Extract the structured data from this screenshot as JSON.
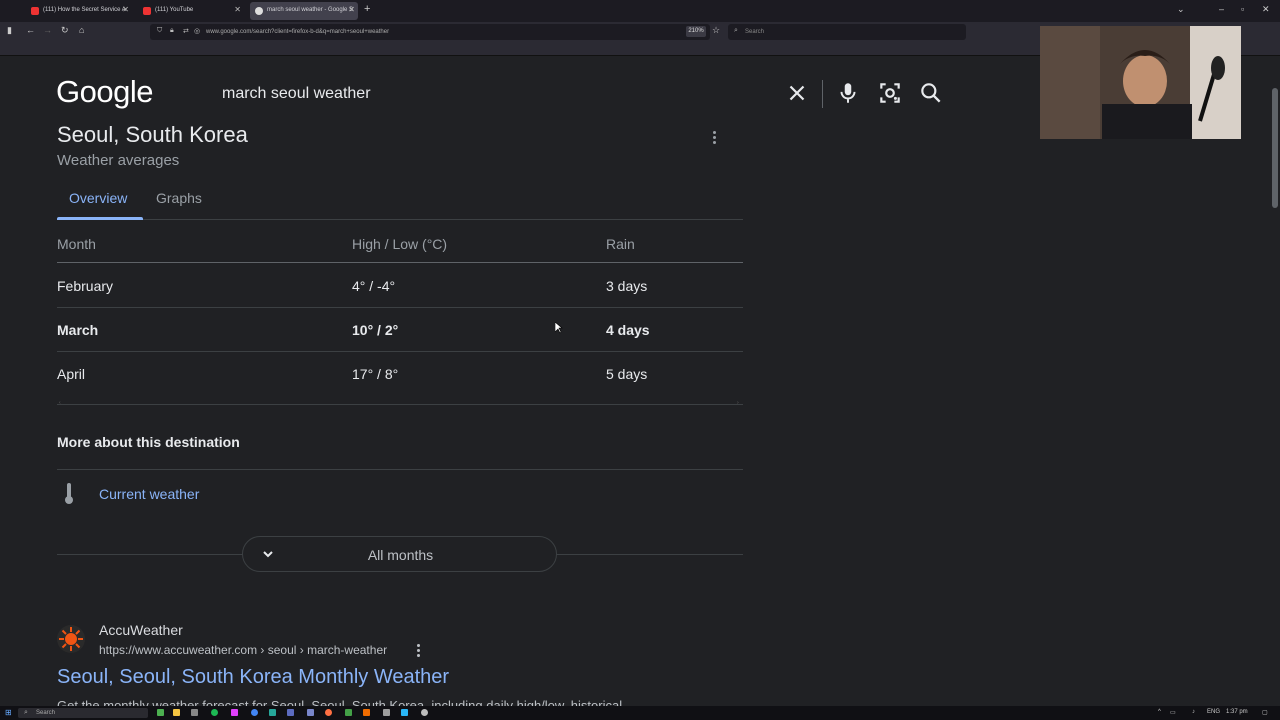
{
  "browser": {
    "tabs": [
      {
        "title": "(111) How the Secret Service A",
        "active": false
      },
      {
        "title": "(111) YouTube",
        "active": false
      },
      {
        "title": "march seoul weather - Google S",
        "active": true
      }
    ],
    "url": "www.google.com/search?client=firefox-b-d&q=march+seoul+weather",
    "zoom": "210%",
    "search_placeholder": "Search"
  },
  "google": {
    "logo": "Google",
    "query": "march seoul weather",
    "icons": [
      "close-icon",
      "microphone-icon",
      "lens-icon",
      "search-icon"
    ]
  },
  "weather_card": {
    "title": "Seoul, South Korea",
    "subtitle": "Weather averages",
    "tabs": [
      "Overview",
      "Graphs"
    ],
    "columns": [
      "Month",
      "High / Low (°C)",
      "Rain"
    ],
    "rows": [
      {
        "month": "February",
        "temp": "4° / -4°",
        "rain": "3 days",
        "highlight": false
      },
      {
        "month": "March",
        "temp": "10° / 2°",
        "rain": "4 days",
        "highlight": true
      },
      {
        "month": "April",
        "temp": "17° / 8°",
        "rain": "5 days",
        "highlight": false
      }
    ],
    "more_title": "More about this destination",
    "current_weather_link": "Current weather",
    "all_months_button": "All months"
  },
  "result": {
    "site_name": "AccuWeather",
    "site_url": "https://www.accuweather.com › seoul › march-weather",
    "title": "Seoul, Seoul, South Korea Monthly Weather",
    "snippet": "Get the monthly weather forecast for Seoul, Seoul, South Korea, including daily high/low, historical"
  },
  "taskbar": {
    "search": "Search",
    "lang": "ENG",
    "time": "1:37 pm"
  },
  "colors": {
    "page_bg": "#202124",
    "link": "#8ab4f8",
    "text": "#e8eaed",
    "muted": "#9aa0a6"
  }
}
